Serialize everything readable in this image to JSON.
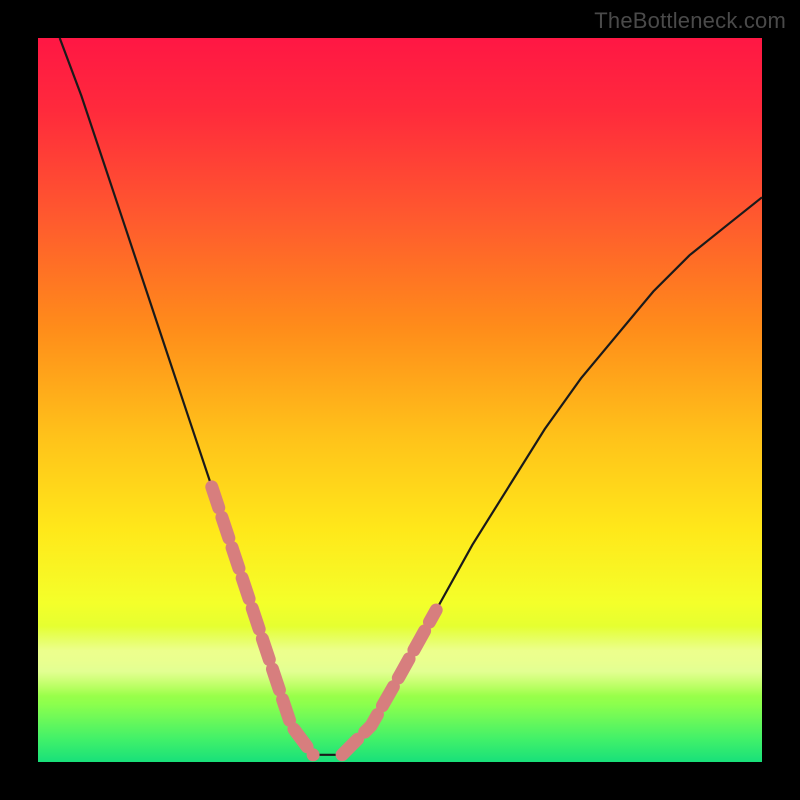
{
  "watermark": "TheBottleneck.com",
  "chart_data": {
    "type": "line",
    "title": "",
    "xlabel": "",
    "ylabel": "",
    "xlim": [
      0,
      100
    ],
    "ylim": [
      0,
      100
    ],
    "grid": false,
    "legend": false,
    "series": [
      {
        "name": "bottleneck-curve",
        "color": "#1a1a1a",
        "x": [
          3,
          6,
          9,
          12,
          15,
          18,
          21,
          24,
          27,
          30,
          33,
          35,
          38,
          42,
          46,
          50,
          55,
          60,
          65,
          70,
          75,
          80,
          85,
          90,
          95,
          100
        ],
        "y": [
          100,
          92,
          83,
          74,
          65,
          56,
          47,
          38,
          29,
          20,
          11,
          5,
          1,
          1,
          5,
          12,
          21,
          30,
          38,
          46,
          53,
          59,
          65,
          70,
          74,
          78
        ]
      },
      {
        "name": "highlighted-region",
        "color": "#d77e7e",
        "note": "dashed/beaded overlay segments on the V-curve near the minimum",
        "segments": [
          {
            "x": [
              24,
              27,
              30,
              33,
              35,
              38
            ],
            "y": [
              38,
              29,
              20,
              11,
              5,
              1
            ]
          },
          {
            "x": [
              42,
              46,
              50,
              55
            ],
            "y": [
              1,
              5,
              12,
              21
            ]
          }
        ]
      }
    ],
    "background_gradient": {
      "direction": "top-to-bottom",
      "stops": [
        {
          "pos": 0.0,
          "color": "#ff1744"
        },
        {
          "pos": 0.4,
          "color": "#ff8c1a"
        },
        {
          "pos": 0.7,
          "color": "#ffe81a"
        },
        {
          "pos": 1.0,
          "color": "#18e07a"
        }
      ]
    }
  }
}
